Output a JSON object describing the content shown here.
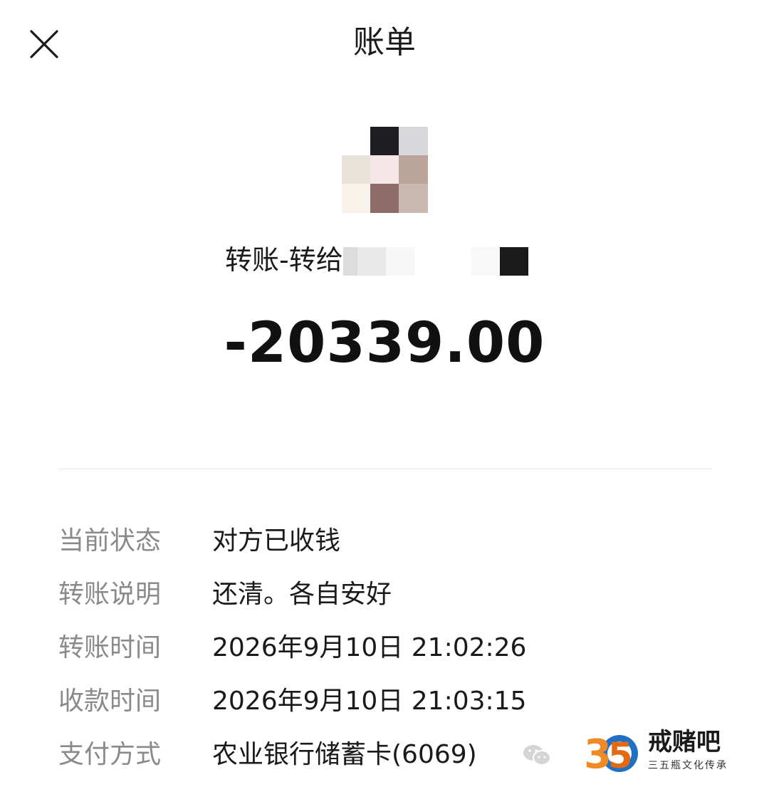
{
  "header": {
    "title": "账单",
    "close_icon": "close-icon"
  },
  "transaction": {
    "payee_prefix": "转账-转给",
    "amount": "-20339.00"
  },
  "details": [
    {
      "label": "当前状态",
      "value": "对方已收钱"
    },
    {
      "label": "转账说明",
      "value": "还清。各自安好"
    },
    {
      "label": "转账时间",
      "value": "2026年9月10日 21:02:26"
    },
    {
      "label": "收款时间",
      "value": "2026年9月10日 21:03:15"
    },
    {
      "label": "支付方式",
      "value": "农业银行储蓄卡(6069)"
    }
  ],
  "watermark": {
    "logo_text": "35",
    "name": "戒赌吧",
    "subtitle": "三五瓶文化传承"
  },
  "colors": {
    "label": "#8a8a8a",
    "text": "#1a1a1a",
    "divider": "#e6e6e6",
    "logo_orange": "#f08a24",
    "logo_blue": "#1f6fc5"
  }
}
